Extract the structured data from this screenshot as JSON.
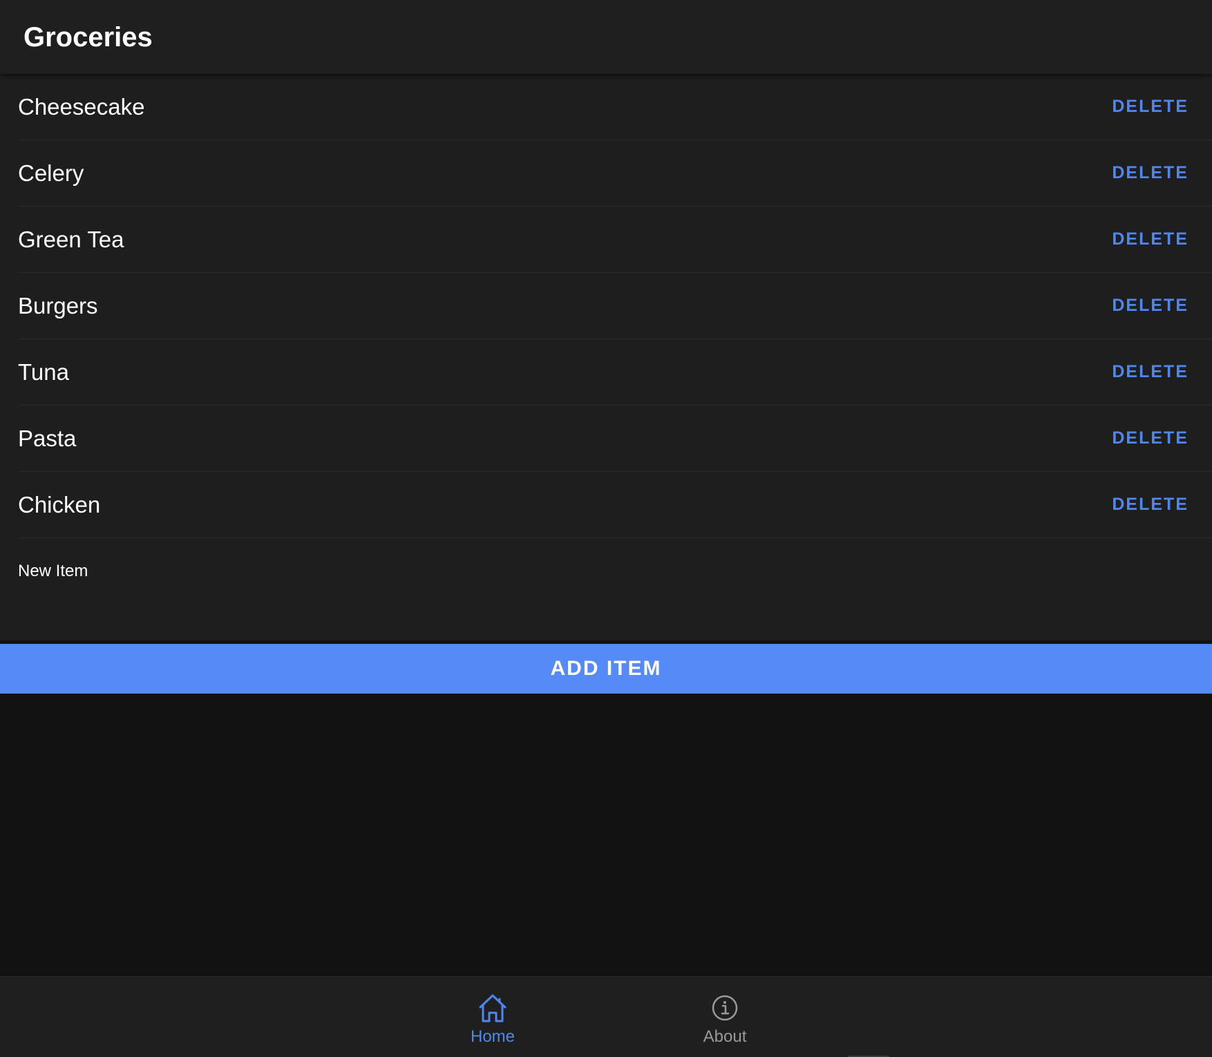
{
  "header": {
    "title": "Groceries"
  },
  "list": {
    "items": [
      {
        "label": "Cheesecake",
        "action": "DELETE"
      },
      {
        "label": "Celery",
        "action": "DELETE"
      },
      {
        "label": "Green Tea",
        "action": "DELETE"
      },
      {
        "label": "Burgers",
        "action": "DELETE"
      },
      {
        "label": "Tuna",
        "action": "DELETE"
      },
      {
        "label": "Pasta",
        "action": "DELETE"
      },
      {
        "label": "Chicken",
        "action": "DELETE"
      }
    ],
    "new_item": {
      "placeholder": "New Item",
      "value": ""
    },
    "add_button": "ADD ITEM"
  },
  "tabbar": {
    "tabs": [
      {
        "label": "Home",
        "icon": "home-icon",
        "active": true
      },
      {
        "label": "About",
        "icon": "info-icon",
        "active": false
      }
    ]
  },
  "colors": {
    "accent": "#568af7",
    "link": "#5087ef",
    "background": "#121212",
    "surface": "#1f1f1f"
  }
}
